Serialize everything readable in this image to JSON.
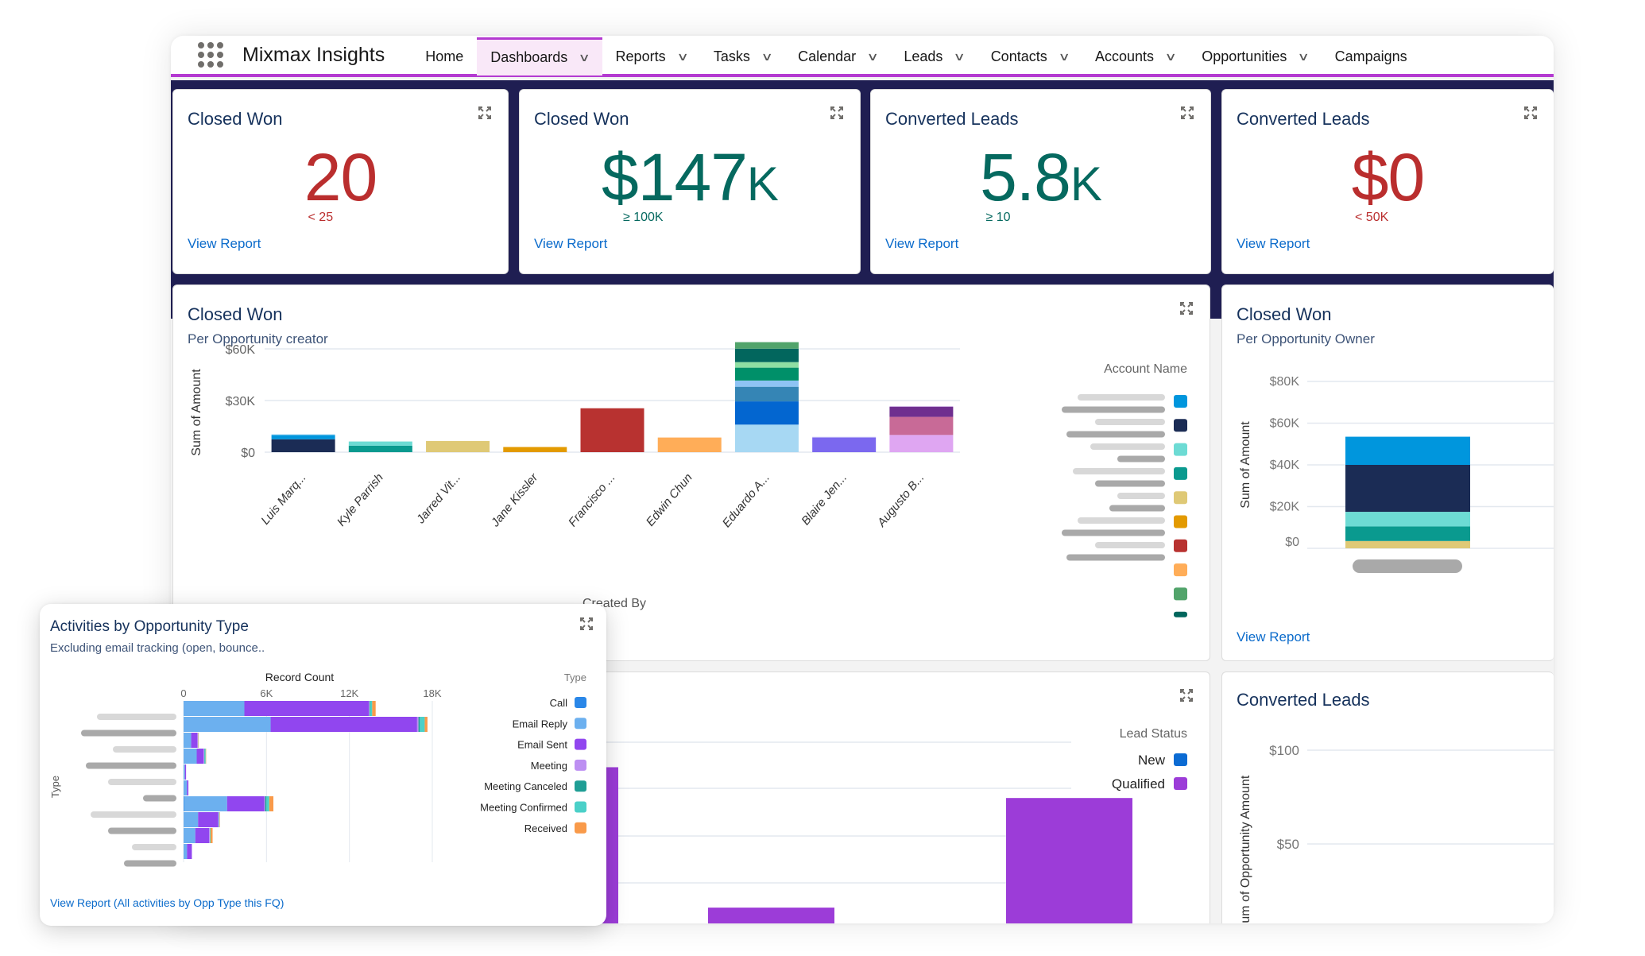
{
  "nav": {
    "app_name": "Mixmax Insights",
    "items": [
      {
        "label": "Home",
        "dropdown": false,
        "active": false
      },
      {
        "label": "Dashboards",
        "dropdown": true,
        "active": true
      },
      {
        "label": "Reports",
        "dropdown": true,
        "active": false
      },
      {
        "label": "Tasks",
        "dropdown": true,
        "active": false
      },
      {
        "label": "Calendar",
        "dropdown": true,
        "active": false
      },
      {
        "label": "Leads",
        "dropdown": true,
        "active": false
      },
      {
        "label": "Contacts",
        "dropdown": true,
        "active": false
      },
      {
        "label": "Accounts",
        "dropdown": true,
        "active": false
      },
      {
        "label": "Opportunities",
        "dropdown": true,
        "active": false
      },
      {
        "label": "Campaigns",
        "dropdown": false,
        "active": false
      }
    ],
    "chevron": "∨"
  },
  "colors": {
    "accent": "#b43ad1",
    "band": "#1f1e52",
    "red": "#ba2e2e",
    "teal": "#05695f",
    "link": "#0b6bcb"
  },
  "kpis": [
    {
      "title": "Closed Won",
      "value": "20",
      "unit": "",
      "target": "< 25",
      "status": "red",
      "link": "View Report"
    },
    {
      "title": "Closed Won",
      "value": "$147",
      "unit": "K",
      "target": "≥ 100K",
      "status": "teal",
      "link": "View Report"
    },
    {
      "title": "Converted Leads",
      "value": "5.8",
      "unit": "K",
      "target": "≥ 10",
      "status": "teal",
      "link": "View Report"
    },
    {
      "title": "Converted Leads",
      "value": "$0",
      "unit": "",
      "target": "< 50K",
      "status": "red",
      "link": "View Report"
    }
  ],
  "chart_data": [
    {
      "id": "closed-won-creator",
      "type": "bar",
      "stacked": true,
      "title": "Closed Won",
      "subtitle": "Per Opportunity creator",
      "xlabel": "Created By",
      "ylabel": "Sum of Amount",
      "ylim": [
        0,
        60000
      ],
      "yticks": [
        {
          "v": 0,
          "label": "$0"
        },
        {
          "v": 30000,
          "label": "$30K"
        },
        {
          "v": 60000,
          "label": "$60K"
        }
      ],
      "categories": [
        "Luis Marq...",
        "Kyle Parrish",
        "Jarred Vit...",
        "Jane Kissler",
        "Francisco ...",
        "Edwin Chun",
        "Eduardo A...",
        "Blaire Jen...",
        "Augusto B..."
      ],
      "stacks": [
        [
          {
            "v": 7500,
            "c": "#1b2c55"
          },
          {
            "v": 2500,
            "c": "#0096dd"
          },
          {
            "v": 400,
            "c": "#a8d7f3"
          }
        ],
        [
          {
            "v": 3800,
            "c": "#0a9a8f"
          },
          {
            "v": 2400,
            "c": "#6ddbd4"
          }
        ],
        [
          {
            "v": 6500,
            "c": "#dfc976"
          }
        ],
        [
          {
            "v": 3000,
            "c": "#e39a00"
          }
        ],
        [
          {
            "v": 25500,
            "c": "#b83230"
          }
        ],
        [
          {
            "v": 8500,
            "c": "#ffad58"
          }
        ],
        [
          {
            "v": 16000,
            "c": "#a7d8f3"
          },
          {
            "v": 13500,
            "c": "#0366d0"
          },
          {
            "v": 8500,
            "c": "#3585b5"
          },
          {
            "v": 3600,
            "c": "#8ec3f4"
          },
          {
            "v": 7500,
            "c": "#009069"
          },
          {
            "v": 3200,
            "c": "#8fdfa3"
          },
          {
            "v": 7800,
            "c": "#02665d"
          },
          {
            "v": 3800,
            "c": "#52a46b"
          }
        ],
        [
          {
            "v": 8500,
            "c": "#7b68ef"
          },
          {
            "v": 400,
            "c": "#c7c2f8"
          }
        ],
        [
          {
            "v": 10000,
            "c": "#dfa6f2"
          },
          {
            "v": 10500,
            "c": "#c86a97"
          },
          {
            "v": 5800,
            "c": "#6f2f8f"
          },
          {
            "v": 400,
            "c": "#c8a8e0"
          }
        ]
      ],
      "legend": {
        "title": "Account Name",
        "position": "right",
        "swatches": [
          "#0096dd",
          "#1b2c55",
          "#6ddbd4",
          "#0a9a8f",
          "#dfc976",
          "#e39a00",
          "#b83230",
          "#ffad58",
          "#52a46b",
          "#02665d"
        ]
      },
      "link": ""
    },
    {
      "id": "closed-won-owner",
      "type": "bar",
      "stacked": true,
      "title": "Closed Won",
      "subtitle": "Per Opportunity Owner",
      "xlabel": "",
      "ylabel": "Sum of Amount",
      "ylim": [
        0,
        80000
      ],
      "yticks": [
        {
          "v": 0,
          "label": "$0"
        },
        {
          "v": 20000,
          "label": "$20K"
        },
        {
          "v": 40000,
          "label": "$40K"
        },
        {
          "v": 60000,
          "label": "$60K"
        },
        {
          "v": 80000,
          "label": "$80K"
        }
      ],
      "categories": [
        "(redacted)"
      ],
      "stacks": [
        [
          {
            "v": 3500,
            "c": "#dfc976"
          },
          {
            "v": 7000,
            "c": "#0a9a8f"
          },
          {
            "v": 7000,
            "c": "#6ddbd4"
          },
          {
            "v": 22500,
            "c": "#1b2c55"
          },
          {
            "v": 13500,
            "c": "#0096dd"
          }
        ]
      ],
      "link": "View Report"
    },
    {
      "id": "activities-by-opp-type",
      "type": "bar",
      "orientation": "horizontal",
      "stacked": true,
      "title": "Activities by Opportunity Type",
      "subtitle": "Excluding email tracking (open, bounce..",
      "xlabel": "Record Count",
      "ylabel": "Type",
      "xlim": [
        0,
        18000
      ],
      "xticks": [
        {
          "v": 0,
          "label": "0"
        },
        {
          "v": 6000,
          "label": "6K"
        },
        {
          "v": 12000,
          "label": "12K"
        },
        {
          "v": 18000,
          "label": "18K"
        }
      ],
      "series_names": [
        "Call",
        "Email Reply",
        "Email Sent",
        "Meeting",
        "Meeting Canceled",
        "Meeting Confirmed",
        "Received"
      ],
      "series_colors": [
        "#2a87e8",
        "#6cb0ef",
        "#9146ef",
        "#bd8ff2",
        "#1f9e95",
        "#4bd0c8",
        "#f99a4a"
      ],
      "rows": [
        [
          0,
          4400,
          9000,
          50,
          50,
          150,
          250
        ],
        [
          0,
          6300,
          10600,
          100,
          100,
          350,
          200
        ],
        [
          0,
          550,
          450,
          50,
          0,
          20,
          30
        ],
        [
          0,
          950,
          500,
          50,
          20,
          80,
          30
        ],
        [
          0,
          100,
          80,
          0,
          0,
          0,
          0
        ],
        [
          0,
          250,
          100,
          0,
          0,
          0,
          0
        ],
        [
          50,
          3100,
          2700,
          50,
          100,
          200,
          300
        ],
        [
          0,
          1050,
          1450,
          50,
          0,
          50,
          30
        ],
        [
          0,
          850,
          1000,
          50,
          0,
          50,
          150
        ],
        [
          0,
          250,
          350,
          0,
          0,
          0,
          0
        ]
      ],
      "legend": {
        "title": "Type",
        "position": "right"
      },
      "link": "View Report (All activities by Opp Type this FQ)"
    },
    {
      "id": "lead-status",
      "type": "bar",
      "title": "",
      "ylabel": "",
      "legend": {
        "title": "Lead Status",
        "position": "right",
        "entries": [
          {
            "label": "New",
            "color": "#0b6bd3"
          },
          {
            "label": "Qualified",
            "color": "#9c3cd8"
          }
        ]
      },
      "note": "partially hidden behind popup; visible bars are Qualified",
      "visible_bar_fractions_of_top_gridline": [
        0.87,
        0.14,
        0.71
      ]
    },
    {
      "id": "converted-leads-chart",
      "type": "bar",
      "title": "Converted Leads",
      "ylabel": "Sum of Opportunity Amount",
      "yticks": [
        {
          "v": 50,
          "label": "$50"
        },
        {
          "v": 100,
          "label": "$100"
        }
      ],
      "values": []
    }
  ]
}
